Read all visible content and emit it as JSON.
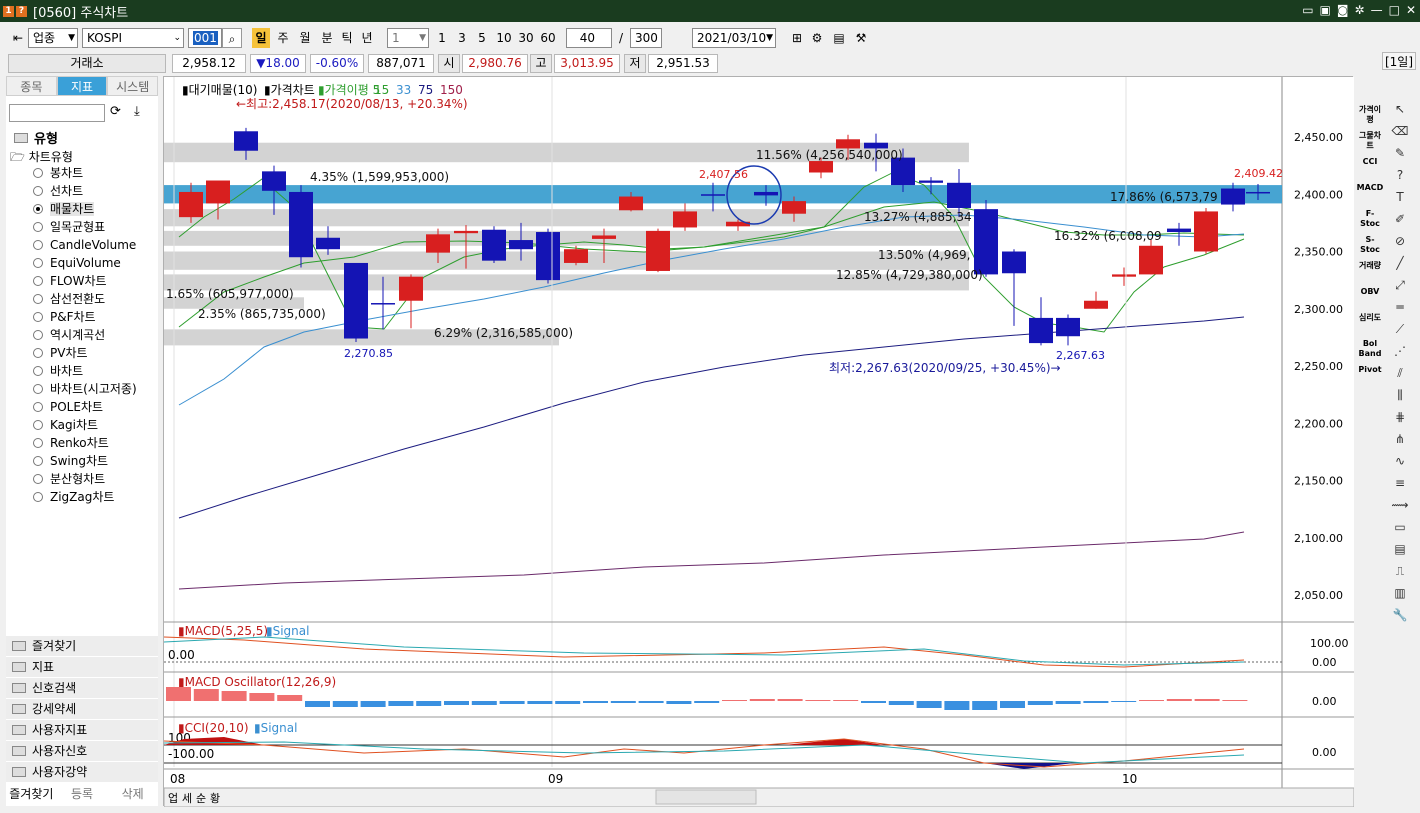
{
  "title": {
    "code": "[0560]",
    "name": "주식차트"
  },
  "toolbar": {
    "market": "업종",
    "index": "KOSPI",
    "code": "001",
    "periods": [
      "일",
      "주",
      "월",
      "분",
      "틱",
      "년"
    ],
    "active_period": "일",
    "interval": "1",
    "quick_intervals": [
      "1",
      "3",
      "5",
      "10",
      "30",
      "60"
    ],
    "count": "40",
    "total": "300",
    "slash": "/",
    "date": "2021/03/10"
  },
  "infobar": {
    "exchange": "거래소",
    "price": "2,958.12",
    "change": "▼18.00",
    "change_pct": "-0.60%",
    "volume": "887,071",
    "open_label": "시",
    "open": "2,980.76",
    "high_label": "고",
    "high": "3,013.95",
    "low_label": "저",
    "low": "2,951.53",
    "period_badge": "[1일]"
  },
  "left": {
    "tabs": [
      "종목",
      "지표",
      "시스템"
    ],
    "active_tab": "지표",
    "tree_root": "유형",
    "tree_folder": "차트유형",
    "items": [
      "봉차트",
      "선차트",
      "매물차트",
      "일목균형표",
      "CandleVolume",
      "EquiVolume",
      "FLOW차트",
      "삼선전환도",
      "P&F차트",
      "역시계곡선",
      "PV차트",
      "바차트",
      "바차트(시고저종)",
      "POLE차트",
      "Kagi차트",
      "Renko차트",
      "Swing차트",
      "분산형차트",
      "ZigZag차트"
    ],
    "selected": "매물차트",
    "folders": [
      "즐겨찾기",
      "지표",
      "신호검색",
      "강세약세",
      "사용자지표",
      "사용자신호",
      "사용자강약"
    ],
    "bottom": [
      "즐겨찾기",
      "등록",
      "삭제"
    ]
  },
  "main": {
    "legend": [
      "대기매물(10)",
      "가격차트",
      "가격이평 5",
      "15",
      "33",
      "75",
      "150"
    ],
    "high_note": "←최고:2,458.17(2020/08/13, +20.34%)",
    "low_note": "최저:2,267.63(2020/09/25, +30.45%)→",
    "labels": [
      "2,407.56",
      "2,270.85",
      "2,267.63",
      "2,409.42"
    ],
    "profile_labels": [
      "4.35% (1,599,953,000)",
      "11.56% (4,256,540,000)",
      "13.27% (4,885,34",
      "17.86% (6,573,79",
      "16.32% (6,008,09",
      "13.50% (4,969,",
      "12.85% (4,729,380,000)",
      "1.65% (605,977,000)",
      "2.35% (865,735,000)",
      "6.29% (2,316,585,000)"
    ],
    "y_ticks": [
      "2,450.00",
      "2,400.00",
      "2,350.00",
      "2,300.00",
      "2,250.00",
      "2,200.00",
      "2,150.00",
      "2,100.00",
      "2,050.00"
    ],
    "x_ticks": [
      "08",
      "09",
      "10"
    ]
  },
  "subcharts": {
    "macd": {
      "legend": [
        "MACD(5,25,5)",
        "Signal"
      ],
      "left_val": "0.00",
      "ticks": [
        "100.00",
        "0.00"
      ]
    },
    "osc": {
      "legend": [
        "MACD Oscillator(12,26,9)"
      ],
      "ticks": [
        "0.00"
      ]
    },
    "cci": {
      "legend": [
        "CCI(20,10)",
        "Signal"
      ],
      "left_vals": [
        "100",
        "-100.00"
      ],
      "ticks": [
        "0.00"
      ]
    }
  },
  "bottombar": {
    "tabs": [
      "업",
      "세",
      "순",
      "황"
    ]
  },
  "rightpanel": [
    "가격이평",
    "그물차트",
    "CCI",
    "MACD",
    "F-Stoc",
    "S-Stoc",
    "거래량",
    "OBV",
    "심리도",
    "Bol Band",
    "Pivot"
  ],
  "colors": {
    "up": "#d81f1f",
    "down": "#1414b4",
    "band_gray": "#c8c8c8",
    "band_blue": "#3d9fd0",
    "ma5": "#2e9e2e",
    "ma15": "#3a8fd0",
    "ma75": "#1c1c80",
    "ma150": "#6a2a6a",
    "title_bg": "#1a3c1f"
  }
}
